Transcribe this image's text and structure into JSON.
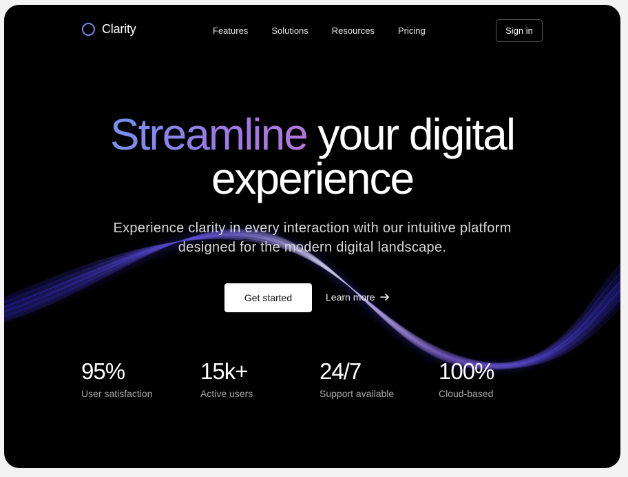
{
  "brand": {
    "name": "Clarity"
  },
  "nav": {
    "links": [
      "Features",
      "Solutions",
      "Resources",
      "Pricing"
    ],
    "signin_label": "Sign in"
  },
  "hero": {
    "headline_accent": "Streamline",
    "headline_rest_line1": "your digital",
    "headline_line2": "experience",
    "subtitle": "Experience clarity in every interaction with our intuitive platform designed for the modern digital landscape."
  },
  "cta": {
    "primary_label": "Get started",
    "secondary_label": "Learn more"
  },
  "stats": [
    {
      "value": "95%",
      "label": "User satisfaction"
    },
    {
      "value": "15k+",
      "label": "Active users"
    },
    {
      "value": "24/7",
      "label": "Support available"
    },
    {
      "value": "100%",
      "label": "Cloud-based"
    }
  ],
  "colors": {
    "background": "#000000",
    "accent_start": "#7491f0",
    "accent_end": "#b377dc",
    "wave_blue": "#3a2fd6",
    "wave_violet": "#8a6ad8"
  },
  "icons": {
    "logo": "ring-logo-icon",
    "arrow": "arrow-right-icon"
  }
}
